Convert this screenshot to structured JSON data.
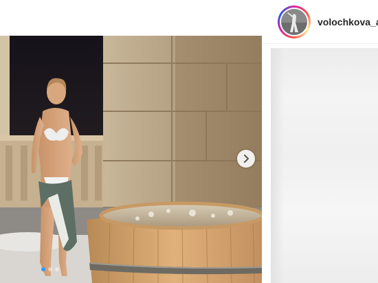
{
  "post": {
    "username": "volochkova_a",
    "carousel": {
      "slide_count": 3,
      "current_slide": 1,
      "next_icon": "chevron-right-icon"
    }
  },
  "colors": {
    "active_dot": "#3897f0",
    "username_text": "#262626",
    "story_ring": [
      "#d6249f",
      "#fd5949",
      "#fdf497",
      "#285AEB"
    ]
  }
}
